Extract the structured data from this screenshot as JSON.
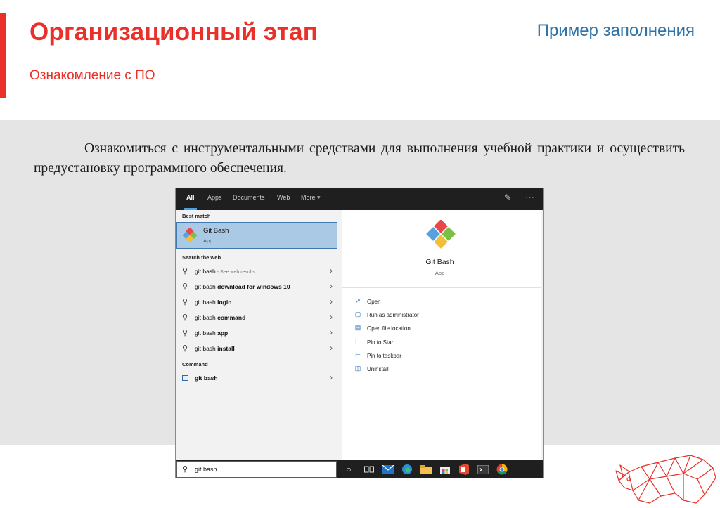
{
  "slide": {
    "title": "Организационный этап",
    "subtitle": "Ознакомление с ПО",
    "example_label": "Пример заполнения",
    "task_text": "Ознакомиться с инструментальными средствами для выполнения учебной практики и осуществить предустановку программного обеспечения."
  },
  "search_window": {
    "tabs": [
      "All",
      "Apps",
      "Documents",
      "Web",
      "More ▾"
    ],
    "active_tab": "All",
    "best_match": {
      "section": "Best match",
      "title": "Git Bash",
      "subtitle": "App"
    },
    "web": {
      "section": "Search the web",
      "items": [
        {
          "prefix": "git bash",
          "bold": "",
          "hint": " - See web results"
        },
        {
          "prefix": "git bash ",
          "bold": "download for windows 10",
          "hint": ""
        },
        {
          "prefix": "git bash ",
          "bold": "login",
          "hint": ""
        },
        {
          "prefix": "git bash ",
          "bold": "command",
          "hint": ""
        },
        {
          "prefix": "git bash ",
          "bold": "app",
          "hint": ""
        },
        {
          "prefix": "git bash ",
          "bold": "install",
          "hint": ""
        }
      ]
    },
    "command": {
      "section": "Command",
      "item": "git bash"
    },
    "preview": {
      "title": "Git Bash",
      "subtitle": "App",
      "actions": [
        "Open",
        "Run as administrator",
        "Open file location",
        "Pin to Start",
        "Pin to taskbar",
        "Uninstall"
      ]
    },
    "search_query": "git bash"
  },
  "colors": {
    "accent_red": "#e8312a",
    "accent_blue": "#2f73a8",
    "selection": "#aac9e4",
    "taskbar": "#1f1f1f"
  }
}
